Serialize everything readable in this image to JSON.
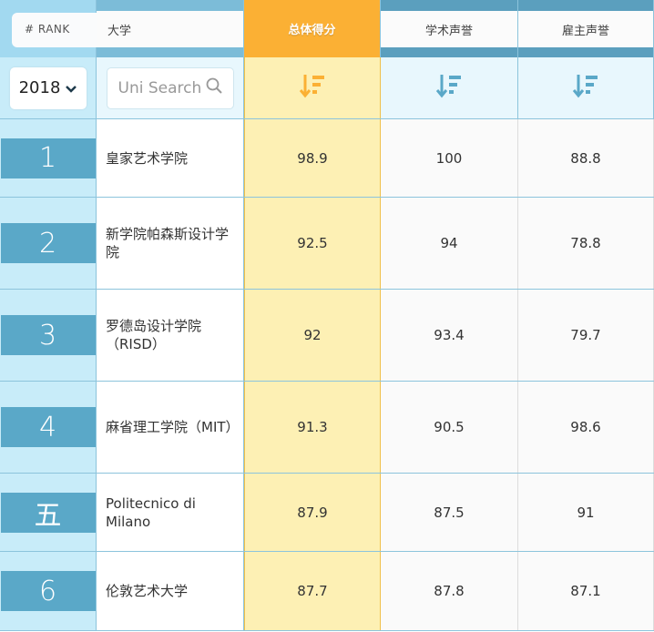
{
  "header": {
    "rank": "# RANK",
    "university": "大学",
    "overall": "总体得分",
    "academic": "学术声誉",
    "employer": "雇主声誉"
  },
  "filters": {
    "year": "2018",
    "search_placeholder": "Uni Search"
  },
  "colors": {
    "accent": "#fbb034",
    "rank_bg": "#5aa8c8"
  },
  "rows": [
    {
      "rank": "1",
      "name": "皇家艺术学院",
      "overall": "98.9",
      "academic": "100",
      "employer": "88.8"
    },
    {
      "rank": "2",
      "name": "新学院帕森斯设计学院",
      "overall": "92.5",
      "academic": "94",
      "employer": "78.8"
    },
    {
      "rank": "3",
      "name": "罗德岛设计学院（RISD）",
      "overall": "92",
      "academic": "93.4",
      "employer": "79.7"
    },
    {
      "rank": "4",
      "name": "麻省理工学院（MIT）",
      "overall": "91.3",
      "academic": "90.5",
      "employer": "98.6"
    },
    {
      "rank": "五",
      "name": "Politecnico di Milano",
      "overall": "87.9",
      "academic": "87.5",
      "employer": "91"
    },
    {
      "rank": "6",
      "name": "伦敦艺术大学",
      "overall": "87.7",
      "academic": "87.8",
      "employer": "87.1"
    }
  ]
}
